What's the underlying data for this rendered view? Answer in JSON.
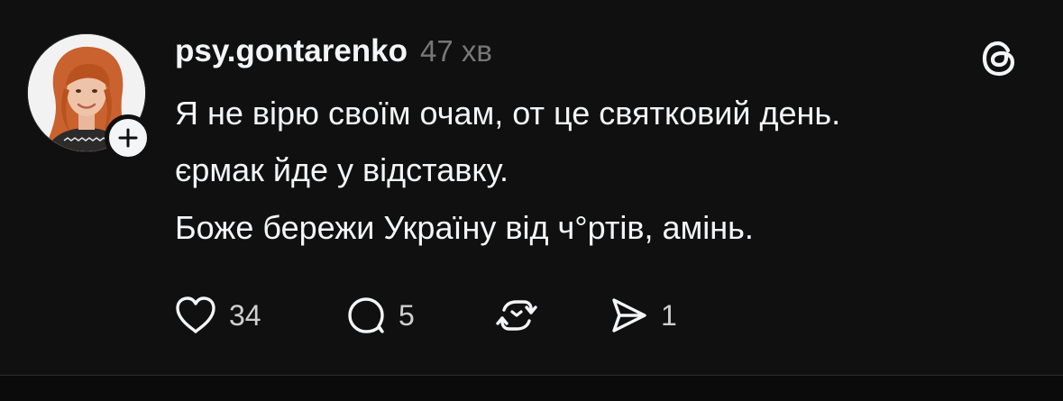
{
  "post": {
    "username": "psy.gontarenko",
    "time": "47 хв",
    "lines": [
      "Я не вірю своїм очам, от це святковий день.",
      "єрмак йде у відставку.",
      "Боже бережи Україну від ч°ртів, амінь."
    ],
    "actions": {
      "likes": "34",
      "comments": "5",
      "shares": "1"
    }
  },
  "colors": {
    "background": "#101010",
    "text": "#f3f5f7",
    "muted": "#777777",
    "hair": "#c9622e"
  },
  "icons": [
    "plus-icon",
    "threads-logo-icon",
    "heart-icon",
    "comment-icon",
    "repost-icon",
    "share-icon"
  ]
}
